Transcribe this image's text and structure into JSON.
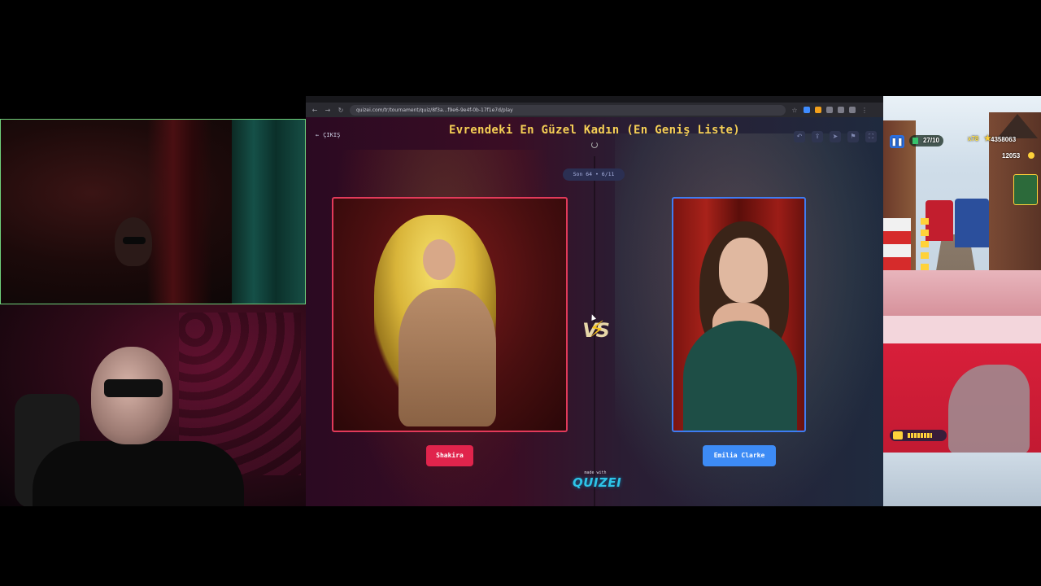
{
  "browser": {
    "url": "quizei.com/tr/tournament/quiz/8f3a...f9e6-9e4f-0b-17f1e7d/play",
    "nav_icons": [
      "back-arrow-icon",
      "forward-arrow-icon",
      "reload-icon"
    ],
    "extension_icons": [
      "star-icon",
      "extension-icon",
      "extension-icon",
      "puzzle-icon",
      "download-icon",
      "profile-icon",
      "menu-dots-icon"
    ]
  },
  "quiz": {
    "back_label": "ÇIKIŞ",
    "back_icon": "arrow-left-icon",
    "title": "Evrendeki En Güzel Kadın (En Geniş Liste)",
    "round_badge": "Son 64 • 6/11",
    "toolbar_icons": [
      "undo-icon",
      "share-icon",
      "send-icon",
      "flag-icon",
      "fullscreen-icon"
    ],
    "left_candidate": "Shakira",
    "right_candidate": "Emilia Clarke",
    "vs_label": "VS",
    "made_with_label": "made with",
    "brand": "QUIZEI"
  },
  "colors": {
    "title": "#f5cf55",
    "left_accent": "#e0244c",
    "right_accent": "#3d8bf5",
    "brand": "#2ec4e8"
  },
  "game": {
    "mission_count": "27/10",
    "multiplier": "x78",
    "score": "4358063",
    "coins": "12053"
  }
}
